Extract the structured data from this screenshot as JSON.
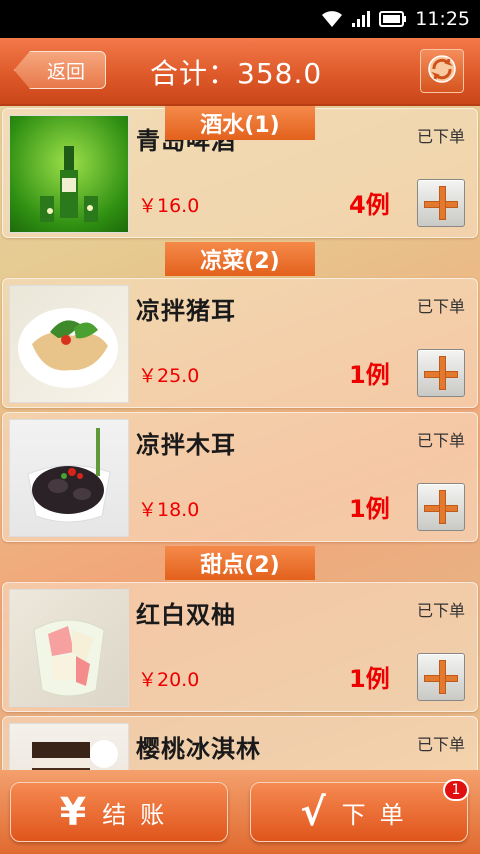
{
  "status_bar": {
    "time": "11:25"
  },
  "header": {
    "back_label": "返回",
    "title": "合计：358.0"
  },
  "categories": [
    {
      "label": "酒水(1)"
    },
    {
      "label": "凉菜(2)"
    },
    {
      "label": "甜点(2)"
    }
  ],
  "items": [
    {
      "name": "青岛啤酒",
      "status": "已下单",
      "price": "￥16.0",
      "qty": "4例"
    },
    {
      "name": "凉拌猪耳",
      "status": "已下单",
      "price": "￥25.0",
      "qty": "1例"
    },
    {
      "name": "凉拌木耳",
      "status": "已下单",
      "price": "￥18.0",
      "qty": "1例"
    },
    {
      "name": "红白双柚",
      "status": "已下单",
      "price": "￥20.0",
      "qty": "1例"
    },
    {
      "name": "樱桃冰淇林",
      "status": "已下单",
      "price": "",
      "qty": ""
    }
  ],
  "footer": {
    "checkout_icon": "¥",
    "checkout_label": "结账",
    "order_icon": "√",
    "order_label": "下单",
    "order_badge": "1"
  },
  "colors": {
    "accent": "#e3611c",
    "price": "#ee0000"
  }
}
